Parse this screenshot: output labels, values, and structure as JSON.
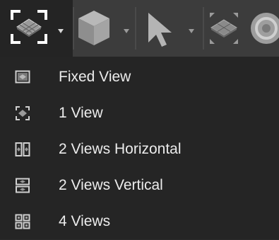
{
  "toolbar": {
    "tools": [
      {
        "icon": "viewport-layout-icon",
        "active": true
      },
      {
        "icon": "cube-icon"
      },
      {
        "icon": "select-arrow-icon"
      },
      {
        "icon": "grid-plane-icon"
      },
      {
        "icon": "sphere-icon"
      }
    ]
  },
  "menu": {
    "items": [
      {
        "label": "Fixed View",
        "icon": "fixed-view-icon"
      },
      {
        "label": "1 View",
        "icon": "one-view-icon"
      },
      {
        "label": "2 Views Horizontal",
        "icon": "two-views-horizontal-icon"
      },
      {
        "label": "2 Views Vertical",
        "icon": "two-views-vertical-icon"
      },
      {
        "label": "4 Views",
        "icon": "four-views-icon"
      }
    ]
  },
  "colors": {
    "toolbar_bg": "#3c3c3c",
    "active_bg": "#242424",
    "menu_bg": "#252525",
    "text": "#ececec",
    "icon": "#d0d0d0"
  }
}
